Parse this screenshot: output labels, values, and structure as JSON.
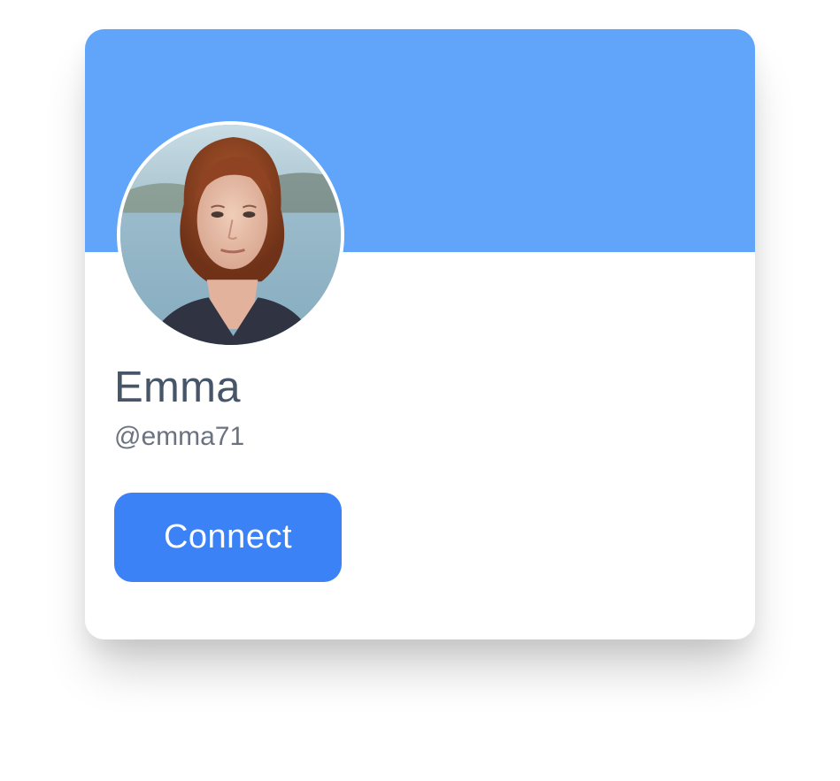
{
  "profile": {
    "name": "Emma",
    "handle": "@emma71",
    "connect_label": "Connect",
    "avatar_icon": "profile-photo"
  },
  "colors": {
    "cover": "#60a5fa",
    "button": "#3b82f6",
    "name_text": "#475569",
    "handle_text": "#6b7280"
  }
}
